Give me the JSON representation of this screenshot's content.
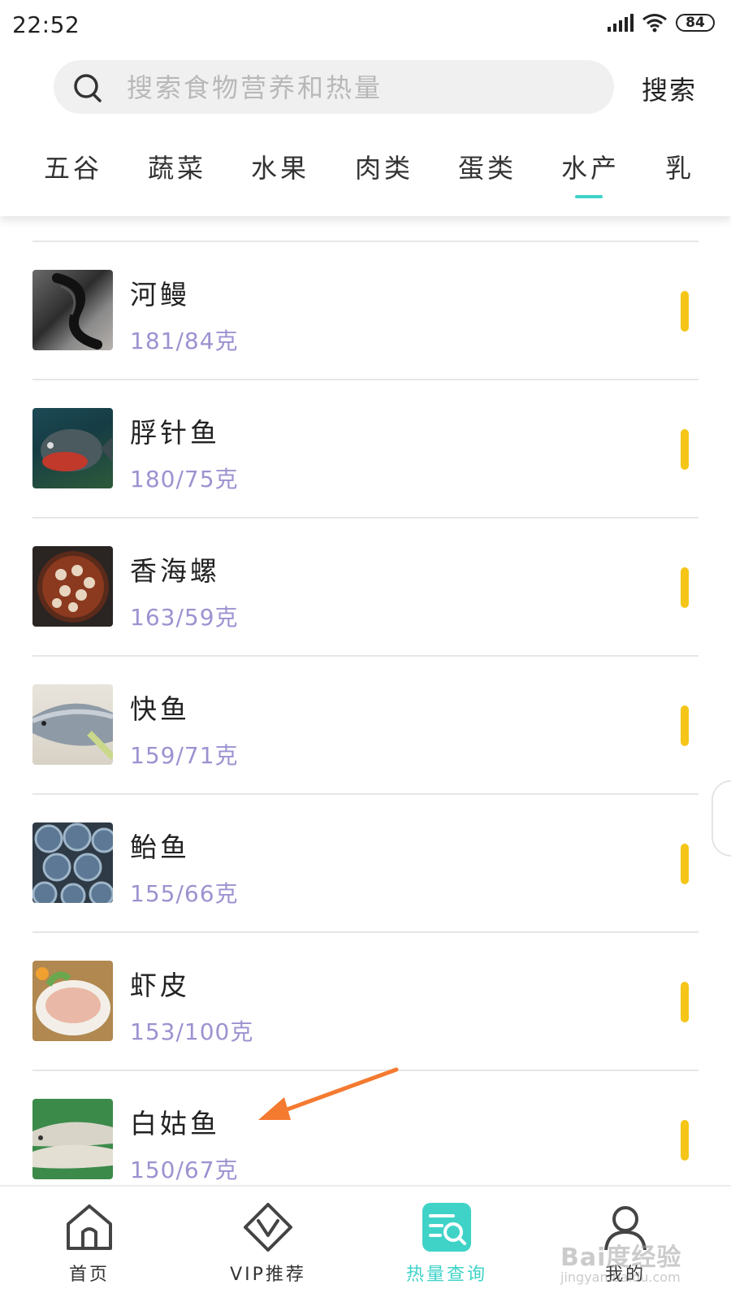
{
  "status_bar": {
    "time": "22:52",
    "battery": "84"
  },
  "search": {
    "placeholder": "搜索食物营养和热量",
    "button_label": "搜索"
  },
  "categories": [
    {
      "label": "五谷",
      "active": false
    },
    {
      "label": "蔬菜",
      "active": false
    },
    {
      "label": "水果",
      "active": false
    },
    {
      "label": "肉类",
      "active": false
    },
    {
      "label": "蛋类",
      "active": false
    },
    {
      "label": "水产",
      "active": true
    },
    {
      "label": "乳",
      "active": false
    }
  ],
  "colors": {
    "accent": "#3fd3c8",
    "calorie_text": "#9b93d0",
    "indicator_bar": "#f5c518",
    "arrow": "#f47a30"
  },
  "foods": [
    {
      "name": "河鳗",
      "calories": "181/84克"
    },
    {
      "name": "脬针鱼",
      "calories": "180/75克"
    },
    {
      "name": "香海螺",
      "calories": "163/59克"
    },
    {
      "name": "快鱼",
      "calories": "159/71克"
    },
    {
      "name": "鲐鱼",
      "calories": "155/66克"
    },
    {
      "name": "虾皮",
      "calories": "153/100克"
    },
    {
      "name": "白姑鱼",
      "calories": "150/67克"
    }
  ],
  "bottom_nav": [
    {
      "label": "首页",
      "icon": "home-icon",
      "active": false
    },
    {
      "label": "VIP推荐",
      "icon": "vip-icon",
      "active": false
    },
    {
      "label": "热量查询",
      "icon": "calorie-search-icon",
      "active": true
    },
    {
      "label": "我的",
      "icon": "profile-icon",
      "active": false
    }
  ],
  "watermark": {
    "text": "Bai度经验",
    "sub": "jingyan.baidu.com"
  }
}
